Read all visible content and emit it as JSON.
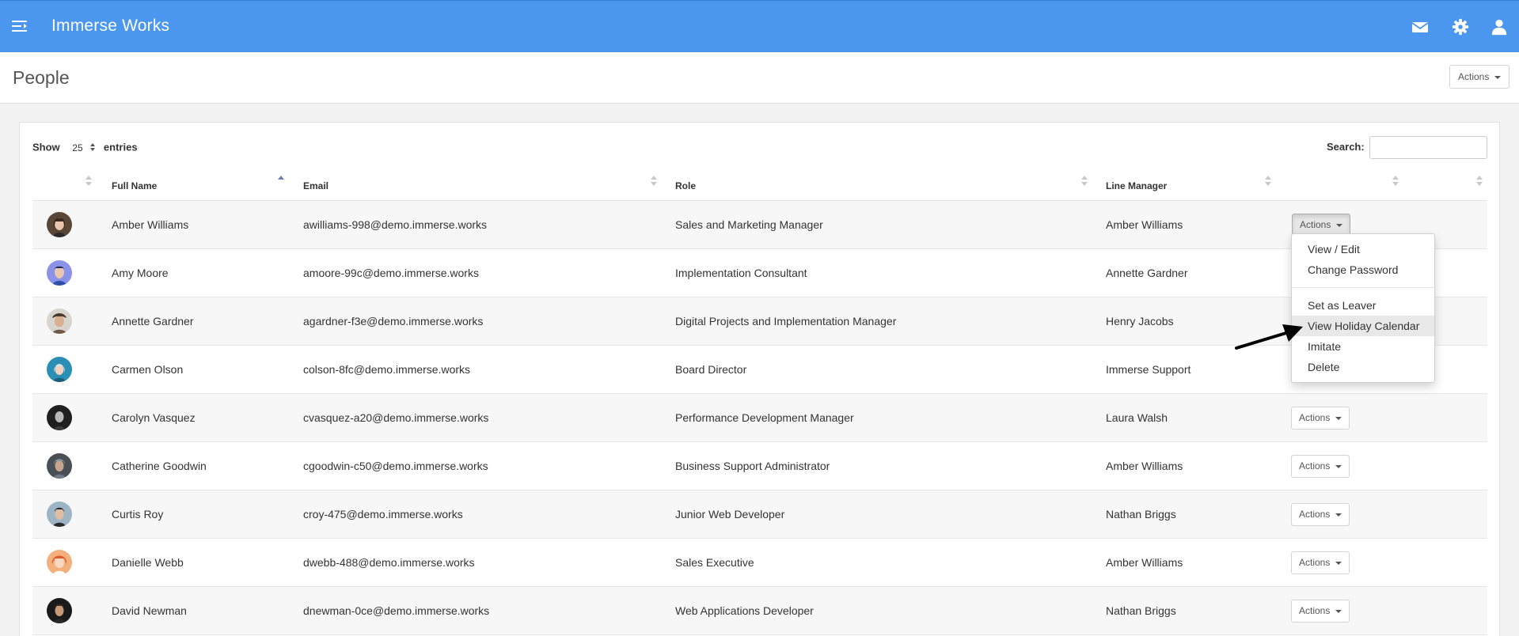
{
  "app": {
    "title": "Immerse Works",
    "icons": [
      "menu-toggle-icon",
      "mail-icon",
      "gear-icon",
      "user-icon"
    ],
    "brand_color": "#4b97ef"
  },
  "page": {
    "title": "People",
    "actions_label": "Actions"
  },
  "table_controls": {
    "show_label": "Show",
    "entries_value": "25",
    "entries_label": "entries",
    "search_label": "Search:",
    "search_value": ""
  },
  "columns": [
    "",
    "Full Name",
    "Email",
    "Role",
    "Line Manager",
    "",
    ""
  ],
  "sort": {
    "column": "Full Name",
    "direction": "ascending"
  },
  "rows": [
    {
      "name": "Amber Williams",
      "email": "awilliams-998@demo.immerse.works",
      "role": "Sales and Marketing Manager",
      "manager": "Amber Williams",
      "actions": "Actions"
    },
    {
      "name": "Amy Moore",
      "email": "amoore-99c@demo.immerse.works",
      "role": "Implementation Consultant",
      "manager": "Annette Gardner",
      "actions": "Actions"
    },
    {
      "name": "Annette Gardner",
      "email": "agardner-f3e@demo.immerse.works",
      "role": "Digital Projects and Implementation Manager",
      "manager": "Henry Jacobs",
      "actions": "Actions"
    },
    {
      "name": "Carmen Olson",
      "email": "colson-8fc@demo.immerse.works",
      "role": "Board Director",
      "manager": "Immerse Support",
      "actions": "Actions"
    },
    {
      "name": "Carolyn Vasquez",
      "email": "cvasquez-a20@demo.immerse.works",
      "role": "Performance Development Manager",
      "manager": "Laura Walsh",
      "actions": "Actions"
    },
    {
      "name": "Catherine Goodwin",
      "email": "cgoodwin-c50@demo.immerse.works",
      "role": "Business Support Administrator",
      "manager": "Amber Williams",
      "actions": "Actions"
    },
    {
      "name": "Curtis Roy",
      "email": "croy-475@demo.immerse.works",
      "role": "Junior Web Developer",
      "manager": "Nathan Briggs",
      "actions": "Actions"
    },
    {
      "name": "Danielle Webb",
      "email": "dwebb-488@demo.immerse.works",
      "role": "Sales Executive",
      "manager": "Amber Williams",
      "actions": "Actions"
    },
    {
      "name": "David Newman",
      "email": "dnewman-0ce@demo.immerse.works",
      "role": "Web Applications Developer",
      "manager": "Nathan Briggs",
      "actions": "Actions"
    }
  ],
  "dropdown": {
    "open_for_row": "Amber Williams",
    "items": [
      "View / Edit",
      "Change Password",
      "Set as Leaver",
      "View Holiday Calendar",
      "Imitate",
      "Delete"
    ],
    "highlighted": "View Holiday Calendar"
  }
}
